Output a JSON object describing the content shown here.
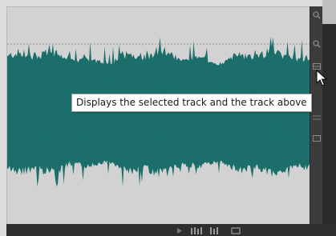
{
  "tooltip": {
    "text": "Displays the selected track and the track above"
  },
  "waveform": {
    "color": "#1b6e6a",
    "background": "#d2d2d2"
  },
  "zoom_rail": {
    "icons": [
      "zoom-in-icon",
      "zoom-out-icon",
      "view-track-icon",
      "view-tracks-icon",
      "view-all-icon"
    ]
  },
  "bottom_bar": {
    "icons": [
      "play-icon",
      "track-view-icon",
      "grid-icon",
      "overview-icon"
    ]
  }
}
